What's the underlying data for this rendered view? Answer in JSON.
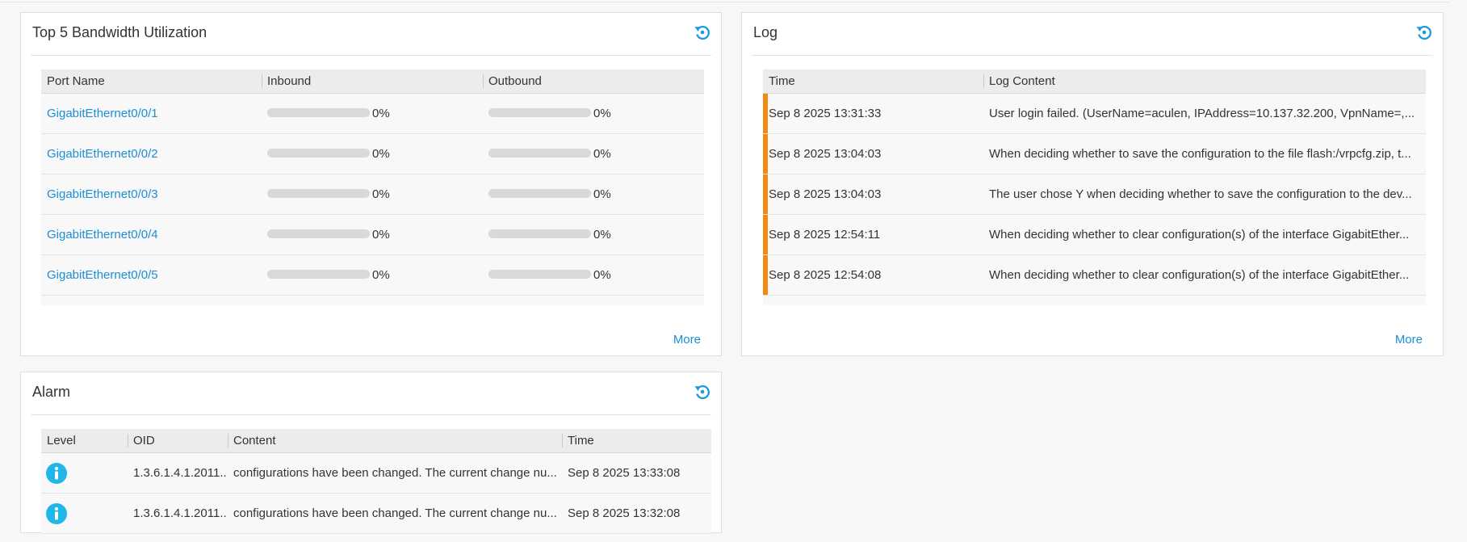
{
  "bandwidth": {
    "title": "Top 5 Bandwidth Utilization",
    "columns": [
      "Port Name",
      "Inbound",
      "Outbound"
    ],
    "rows": [
      {
        "port": "GigabitEthernet0/0/1",
        "inbound": "0%",
        "outbound": "0%",
        "inbound_value": 0,
        "outbound_value": 0
      },
      {
        "port": "GigabitEthernet0/0/2",
        "inbound": "0%",
        "outbound": "0%",
        "inbound_value": 0,
        "outbound_value": 0
      },
      {
        "port": "GigabitEthernet0/0/3",
        "inbound": "0%",
        "outbound": "0%",
        "inbound_value": 0,
        "outbound_value": 0
      },
      {
        "port": "GigabitEthernet0/0/4",
        "inbound": "0%",
        "outbound": "0%",
        "inbound_value": 0,
        "outbound_value": 0
      },
      {
        "port": "GigabitEthernet0/0/5",
        "inbound": "0%",
        "outbound": "0%",
        "inbound_value": 0,
        "outbound_value": 0
      }
    ],
    "more": "More"
  },
  "log": {
    "title": "Log",
    "columns": [
      "Time",
      "Log Content"
    ],
    "rows": [
      {
        "time": "Sep  8 2025 13:31:33",
        "content": "User login failed. (UserName=aculen, IPAddress=10.137.32.200, VpnName=,..."
      },
      {
        "time": "Sep  8 2025 13:04:03",
        "content": "When deciding whether to save the configuration to the file flash:/vrpcfg.zip, t..."
      },
      {
        "time": "Sep  8 2025 13:04:03",
        "content": "The user chose Y when deciding whether to save the configuration to the dev..."
      },
      {
        "time": "Sep  8 2025 12:54:11",
        "content": "When deciding whether to clear configuration(s) of the interface GigabitEther..."
      },
      {
        "time": "Sep  8 2025 12:54:08",
        "content": "When deciding whether to clear configuration(s) of the interface GigabitEther..."
      }
    ],
    "more": "More"
  },
  "alarm": {
    "title": "Alarm",
    "columns": [
      "Level",
      "OID",
      "Content",
      "Time"
    ],
    "rows": [
      {
        "level_icon": "info-icon",
        "oid": "1.3.6.1.4.1.2011...",
        "content": "configurations have been changed. The current change nu...",
        "time": "Sep  8 2025 13:33:08"
      },
      {
        "level_icon": "info-icon",
        "oid": "1.3.6.1.4.1.2011...",
        "content": "configurations have been changed. The current change nu...",
        "time": "Sep  8 2025 13:32:08"
      }
    ]
  },
  "icons": {
    "refresh": "refresh-icon"
  },
  "colors": {
    "accent": "#1a8fd6",
    "log_marker": "#f08a12",
    "info": "#1fb6e8"
  }
}
